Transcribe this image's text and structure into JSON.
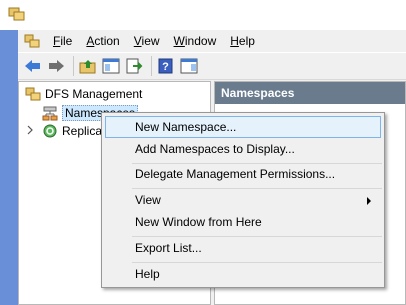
{
  "menubar": {
    "items": [
      {
        "underline": "F",
        "rest": "ile"
      },
      {
        "underline": "A",
        "rest": "ction"
      },
      {
        "underline": "V",
        "rest": "iew"
      },
      {
        "underline": "W",
        "rest": "indow"
      },
      {
        "underline": "H",
        "rest": "elp"
      }
    ]
  },
  "tree": {
    "root": "DFS Management",
    "namespaces": "Namespaces",
    "replication": "Replication"
  },
  "right_pane": {
    "header": "Namespaces"
  },
  "context_menu": {
    "items": [
      "New Namespace...",
      "Add Namespaces to Display...",
      "Delegate Management Permissions...",
      "View",
      "New Window from Here",
      "Export List...",
      "Help"
    ]
  },
  "colors": {
    "accent_blue": "#6a8fd9",
    "header_gray": "#6a7b8e",
    "highlight": "#e5f1fb"
  }
}
